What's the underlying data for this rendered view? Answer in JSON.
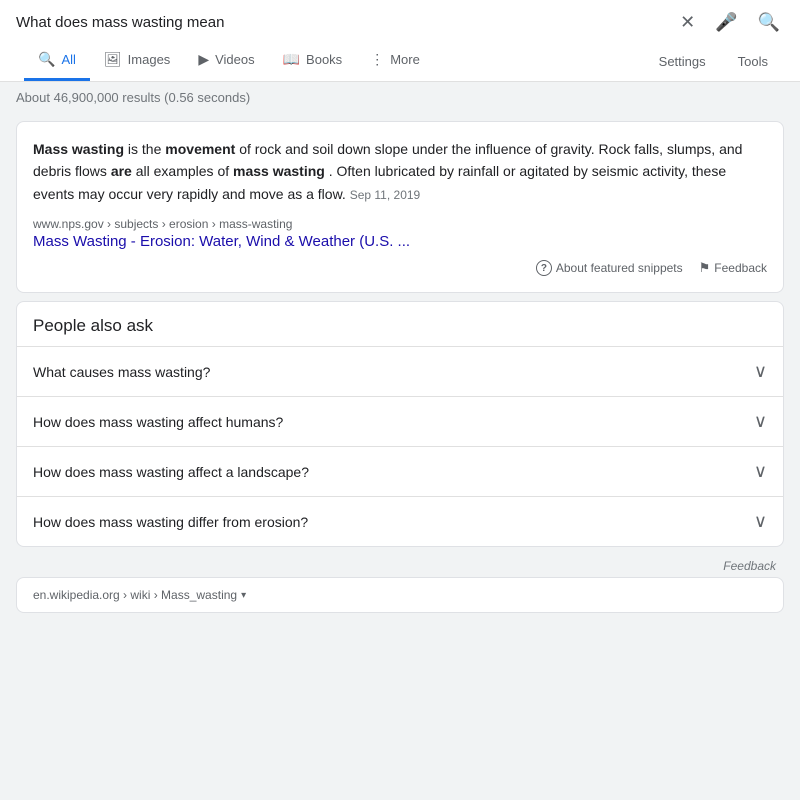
{
  "topbar": {
    "search_query": "What does mass wasting mean",
    "close_icon": "✕",
    "mic_icon": "🎤",
    "search_icon": "🔍"
  },
  "nav": {
    "tabs": [
      {
        "id": "all",
        "label": "All",
        "icon": "🔍",
        "active": true
      },
      {
        "id": "images",
        "label": "Images",
        "icon": "🖼"
      },
      {
        "id": "videos",
        "label": "Videos",
        "icon": "▶"
      },
      {
        "id": "books",
        "label": "Books",
        "icon": "📖"
      },
      {
        "id": "more",
        "label": "More",
        "icon": "⋮"
      }
    ],
    "right_items": [
      "Settings",
      "Tools"
    ]
  },
  "results_info": "About 46,900,000 results (0.56 seconds)",
  "featured_snippet": {
    "text_parts": [
      {
        "text": "Mass wasting",
        "bold": true
      },
      {
        "text": " is the "
      },
      {
        "text": "movement",
        "bold": true
      },
      {
        "text": " of rock and soil down slope under the influence of gravity. Rock falls, slumps, and debris flows "
      },
      {
        "text": "are",
        "bold": true
      },
      {
        "text": " all examples of "
      },
      {
        "text": "mass wasting",
        "bold": true
      },
      {
        "text": ". Often lubricated by rainfall or agitated by seismic activity, these events may occur very rapidly and move as a flow."
      }
    ],
    "date": "Sep 11, 2019",
    "url_breadcrumb": "www.nps.gov › subjects › erosion › mass-wasting",
    "link_text": "Mass Wasting - Erosion: Water, Wind & Weather (U.S. ...",
    "footer": {
      "about_label": "About featured snippets",
      "feedback_label": "Feedback"
    }
  },
  "paa": {
    "title": "People also ask",
    "questions": [
      "What causes mass wasting?",
      "How does mass wasting affect humans?",
      "How does mass wasting affect a landscape?",
      "How does mass wasting differ from erosion?"
    ]
  },
  "bottom_feedback": "Feedback",
  "wiki_result": {
    "url": "en.wikipedia.org › wiki › Mass_wasting"
  },
  "colors": {
    "active_tab": "#1a73e8",
    "link": "#1a0dab",
    "text_secondary": "#5f6368",
    "border": "#dfe1e5"
  }
}
